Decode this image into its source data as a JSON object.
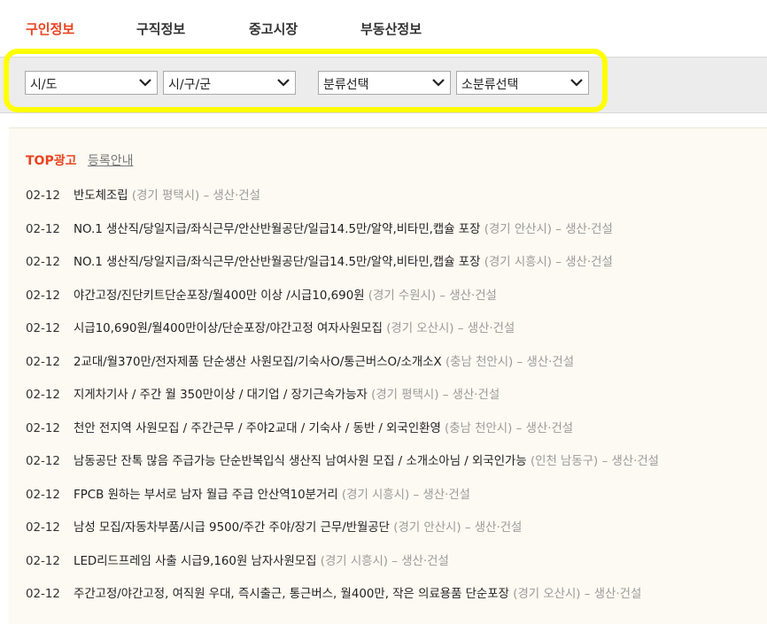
{
  "tabs": [
    {
      "label": "구인정보",
      "active": true
    },
    {
      "label": "구직정보",
      "active": false
    },
    {
      "label": "중고시장",
      "active": false
    },
    {
      "label": "부동산정보",
      "active": false
    }
  ],
  "filters": {
    "province": "시/도",
    "district": "시/구/군",
    "category": "분류선택",
    "subcategory": "소분류선택"
  },
  "top_ads": {
    "title": "TOP광고",
    "guide_link": "등록안내"
  },
  "listings": [
    {
      "date": "02-12",
      "title": "반도체조립",
      "location": "(경기 평택시)",
      "category": " – 생산·건설"
    },
    {
      "date": "02-12",
      "title": "NO.1 생산직/당일지급/좌식근무/안산반월공단/일급14.5만/알약,비타민,캡슐 포장",
      "location": "(경기 안산시)",
      "category": " – 생산·건설"
    },
    {
      "date": "02-12",
      "title": "NO.1 생산직/당일지급/좌식근무/안산반월공단/일급14.5만/알약,비타민,캡슐 포장",
      "location": "(경기 시흥시)",
      "category": " – 생산·건설"
    },
    {
      "date": "02-12",
      "title": "야간고정/진단키트단순포장/월400만 이상 /시급10,690원",
      "location": "(경기 수원시)",
      "category": " – 생산·건설"
    },
    {
      "date": "02-12",
      "title": "시급10,690원/월400만이상/단순포장/야간고정 여자사원모집",
      "location": "(경기 오산시)",
      "category": " – 생산·건설"
    },
    {
      "date": "02-12",
      "title": "2교대/월370만/전자제품 단순생산 사원모집/기숙사O/통근버스O/소개소X",
      "location": "(충남 천안시)",
      "category": " – 생산·건설"
    },
    {
      "date": "02-12",
      "title": "지게차기사 / 주간 월 350만이상 / 대기업 / 장기근속가능자",
      "location": "(경기 평택시)",
      "category": " – 생산·건설"
    },
    {
      "date": "02-12",
      "title": "천안 전지역 사원모집 / 주간근무 / 주야2교대 / 기숙사 / 동반 / 외국인환영",
      "location": "(충남 천안시)",
      "category": " – 생산·건설"
    },
    {
      "date": "02-12",
      "title": "남동공단 잔톡 많음 주급가능 단순반복입식 생산직 남여사원 모집 / 소개소아님 / 외국인가능",
      "location": "(인천 남동구)",
      "category": " – 생산·건설"
    },
    {
      "date": "02-12",
      "title": "FPCB 원하는 부서로 남자 월급 주급 안산역10분거리",
      "location": "(경기 시흥시)",
      "category": " – 생산·건설"
    },
    {
      "date": "02-12",
      "title": "남성 모집/자동차부품/시급 9500/주간 주야/장기 근무/반월공단",
      "location": "(경기 안산시)",
      "category": " – 생산·건설"
    },
    {
      "date": "02-12",
      "title": "LED리드프레임 사출 시급9,160원 남자사원모집",
      "location": "(경기 시흥시)",
      "category": " – 생산·건설"
    },
    {
      "date": "02-12",
      "title": "주간고정/야간고정, 여직원 우대, 즉시출근, 통근버스, 월400만, 작은 의료용품 단순포장",
      "location": "(경기 오산시)",
      "category": " – 생산·건설"
    }
  ],
  "colors": {
    "accent": "#e8431f",
    "highlight": "#ffff00",
    "panel_bg": "#fcfaf2",
    "muted_text": "#9a9a9a"
  },
  "icons": {
    "dropdown": "chevron-down-icon"
  }
}
